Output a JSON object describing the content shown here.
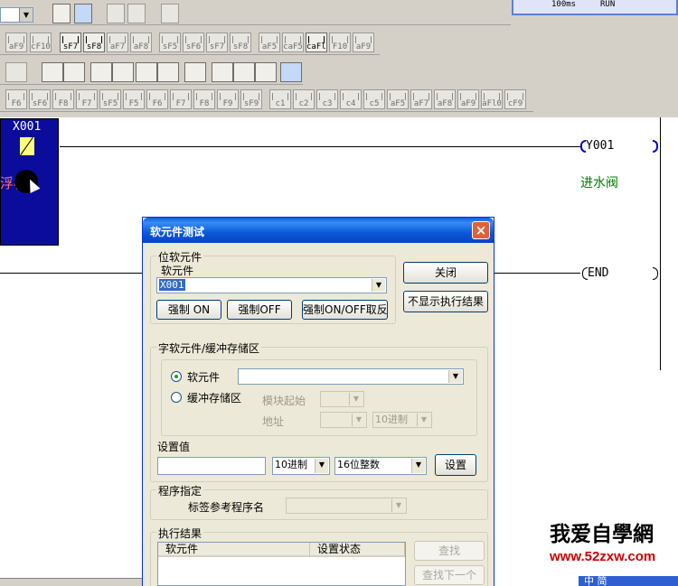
{
  "status": {
    "time": "100ms",
    "mode": "RUN"
  },
  "toolbar_row2": [
    "sF7",
    "sF8",
    "aF7",
    "aF8",
    "sF5",
    "sF6",
    "sF7",
    "sF8",
    "aF5",
    "caF5",
    "caFl0",
    "F10",
    "aF9"
  ],
  "toolbar_row2_left": [
    "aF9",
    "cF10"
  ],
  "toolbar_row4": [
    "F6",
    "sF6",
    "F8",
    "F7",
    "sF5",
    "F5",
    "F6",
    "F7",
    "F8",
    "F9",
    "sF9",
    "c1",
    "c2",
    "c3",
    "c4",
    "c5",
    "aF5",
    "aF7",
    "aF8",
    "aF9",
    "aFl0",
    "cF9"
  ],
  "ladder": {
    "contact": "X001",
    "contact_comment": "浮标",
    "coil": "Y001",
    "coil_comment": "进水阀",
    "end": "END"
  },
  "dialog": {
    "title": "软元件测试",
    "bit_group": "位软元件",
    "device_label": "软元件",
    "device_value": "X001",
    "force_on": "强制 ON",
    "force_off": "强制OFF",
    "force_toggle": "强制ON/OFF取反",
    "close": "关闭",
    "hide_results": "不显示执行结果",
    "word_group": "字软元件/缓冲存储区",
    "radio_device": "软元件",
    "radio_buffer": "缓冲存储区",
    "module_start": "模块起始",
    "address": "地址",
    "radix_disabled": "10进制",
    "set_value_label": "设置值",
    "radix": "10进制",
    "data_type": "16位整数",
    "set_button": "设置",
    "program_group": "程序指定",
    "label_ref": "标签参考程序名",
    "results_group": "执行结果",
    "col_device": "软元件",
    "col_state": "设置状态",
    "find": "查找",
    "find_next": "查找下一个"
  },
  "watermark": {
    "text": "我爱自學網",
    "url": "www.52zxw.com",
    "strip": "中 简"
  }
}
